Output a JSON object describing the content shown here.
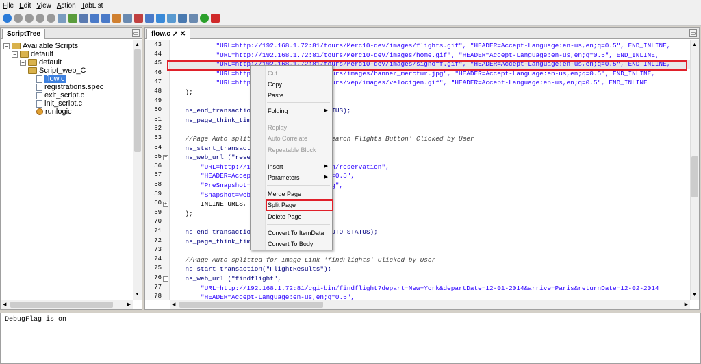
{
  "menu": [
    "File",
    "Edit",
    "View",
    "Action",
    "TabList"
  ],
  "left_panel": {
    "tab": "ScriptTree",
    "tree": [
      {
        "label": "Available Scripts",
        "indent": 0
      },
      {
        "label": "default",
        "indent": 1
      },
      {
        "label": "default",
        "indent": 2
      },
      {
        "label": "Script_web_C",
        "indent": 3
      },
      {
        "label": "flow.c",
        "indent": 4,
        "selected": true
      },
      {
        "label": "registrations.spec",
        "indent": 4
      },
      {
        "label": "exit_script.c",
        "indent": 4
      },
      {
        "label": "init_script.c",
        "indent": 4
      },
      {
        "label": "runlogic",
        "indent": 4
      }
    ]
  },
  "editor": {
    "tab": "flow.c",
    "lines": [
      {
        "n": "43",
        "text": "            \"URL=http://192.168.1.72:81/tours/Merc10-dev/images/flights.gif\", \"HEADER=Accept-Language:en-us,en;q=0.5\", END_INLINE,",
        "kind": "str"
      },
      {
        "n": "44",
        "text": "            \"URL=http://192.168.1.72:81/tours/Merc10-dev/images/home.gif\", \"HEADER=Accept-Language:en-us,en;q=0.5\", END_INLINE,",
        "kind": "str"
      },
      {
        "n": "45",
        "text": "            \"URL=http://192.168.1.72:81/tours/Merc10-dev/images/signoff.gif\", \"HEADER=Accept-Language:en-us,en;q=0.5\", END_INLINE,",
        "kind": "str",
        "hl": true
      },
      {
        "n": "46",
        "text": "            \"URL=http://192.168.1.72:81/tours/images/banner_merctur.jpg\", \"HEADER=Accept-Language:en-us,en;q=0.5\", END_INLINE,",
        "kind": "str"
      },
      {
        "n": "47",
        "text": "            \"URL=http://192.168.1.72:81/tours/vep/images/velocigen.gif\", \"HEADER=Accept-Language:en-us,en;q=0.5\", END_INLINE",
        "kind": "str"
      },
      {
        "n": "48",
        "text": "    );",
        "kind": "plain"
      },
      {
        "n": "49",
        "text": "",
        "kind": "plain"
      },
      {
        "n": "50",
        "text": "    ns_end_transaction(\"home\", NS_AUTO_STATUS);",
        "kind": "fn"
      },
      {
        "n": "51",
        "text": "    ns_page_think_time(0);",
        "kind": "fn"
      },
      {
        "n": "52",
        "text": "",
        "kind": "plain"
      },
      {
        "n": "53",
        "text": "    //Page Auto splitted for Image Link 'Search Flights Button' Clicked by User",
        "kind": "cmt"
      },
      {
        "n": "54",
        "text": "    ns_start_transaction(\"reservation\");",
        "kind": "fn"
      },
      {
        "n": "55",
        "text": "    ns_web_url (\"reservation\",",
        "kind": "fn",
        "fold": true
      },
      {
        "n": "56",
        "text": "        \"URL=http://192.168.1.72:81/cgi-bin/reservation\",",
        "kind": "str"
      },
      {
        "n": "57",
        "text": "        \"HEADER=Accept-Language:en-us,en;q=0.5\",",
        "kind": "str"
      },
      {
        "n": "58",
        "text": "        \"PreSnapshot=webpage_1413537304.png\",",
        "kind": "str"
      },
      {
        "n": "59",
        "text": "        \"Snapshot=webpage_1413537304.png\",",
        "kind": "str"
      },
      {
        "n": "60",
        "text": "        INLINE_URLS,",
        "kind": "plain",
        "fold": true
      },
      {
        "n": "69",
        "text": "    );",
        "kind": "plain"
      },
      {
        "n": "70",
        "text": "",
        "kind": "plain"
      },
      {
        "n": "71",
        "text": "    ns_end_transaction(\"reservation\", NS_AUTO_STATUS);",
        "kind": "fn"
      },
      {
        "n": "72",
        "text": "    ns_page_think_time(0);",
        "kind": "fn"
      },
      {
        "n": "73",
        "text": "",
        "kind": "plain"
      },
      {
        "n": "74",
        "text": "    //Page Auto splitted for Image Link 'findFlights' Clicked by User",
        "kind": "cmt"
      },
      {
        "n": "75",
        "text": "    ns_start_transaction(\"FlightResults\");",
        "kind": "fn"
      },
      {
        "n": "76",
        "text": "    ns_web_url (\"findflight\",",
        "kind": "fn",
        "fold": true
      },
      {
        "n": "77",
        "text": "        \"URL=http://192.168.1.72:81/cgi-bin/findflight?depart=New+York&departDate=12-01-2014&arrive=Paris&returnDate=12-02-2014",
        "kind": "str"
      },
      {
        "n": "78",
        "text": "        \"HEADER=Accept-Language:en-us,en;q=0.5\",",
        "kind": "str"
      }
    ]
  },
  "context_menu": [
    {
      "label": "Cut",
      "disabled": true
    },
    {
      "label": "Copy"
    },
    {
      "label": "Paste"
    },
    {
      "sep": true
    },
    {
      "label": "Folding",
      "sub": true
    },
    {
      "sep": true
    },
    {
      "label": "Replay",
      "disabled": true
    },
    {
      "label": "Auto Correlate",
      "disabled": true
    },
    {
      "label": "Repeatable Block",
      "disabled": true
    },
    {
      "sep": true
    },
    {
      "label": "Insert",
      "sub": true
    },
    {
      "label": "Parameters",
      "sub": true
    },
    {
      "sep": true
    },
    {
      "label": "Merge Page"
    },
    {
      "label": "Split Page",
      "highlighted": true
    },
    {
      "label": "Delete Page"
    },
    {
      "sep": true
    },
    {
      "label": "Convert To ItemData"
    },
    {
      "label": "Convert To Body"
    }
  ],
  "debug": {
    "text": "DebugFlag is on"
  }
}
